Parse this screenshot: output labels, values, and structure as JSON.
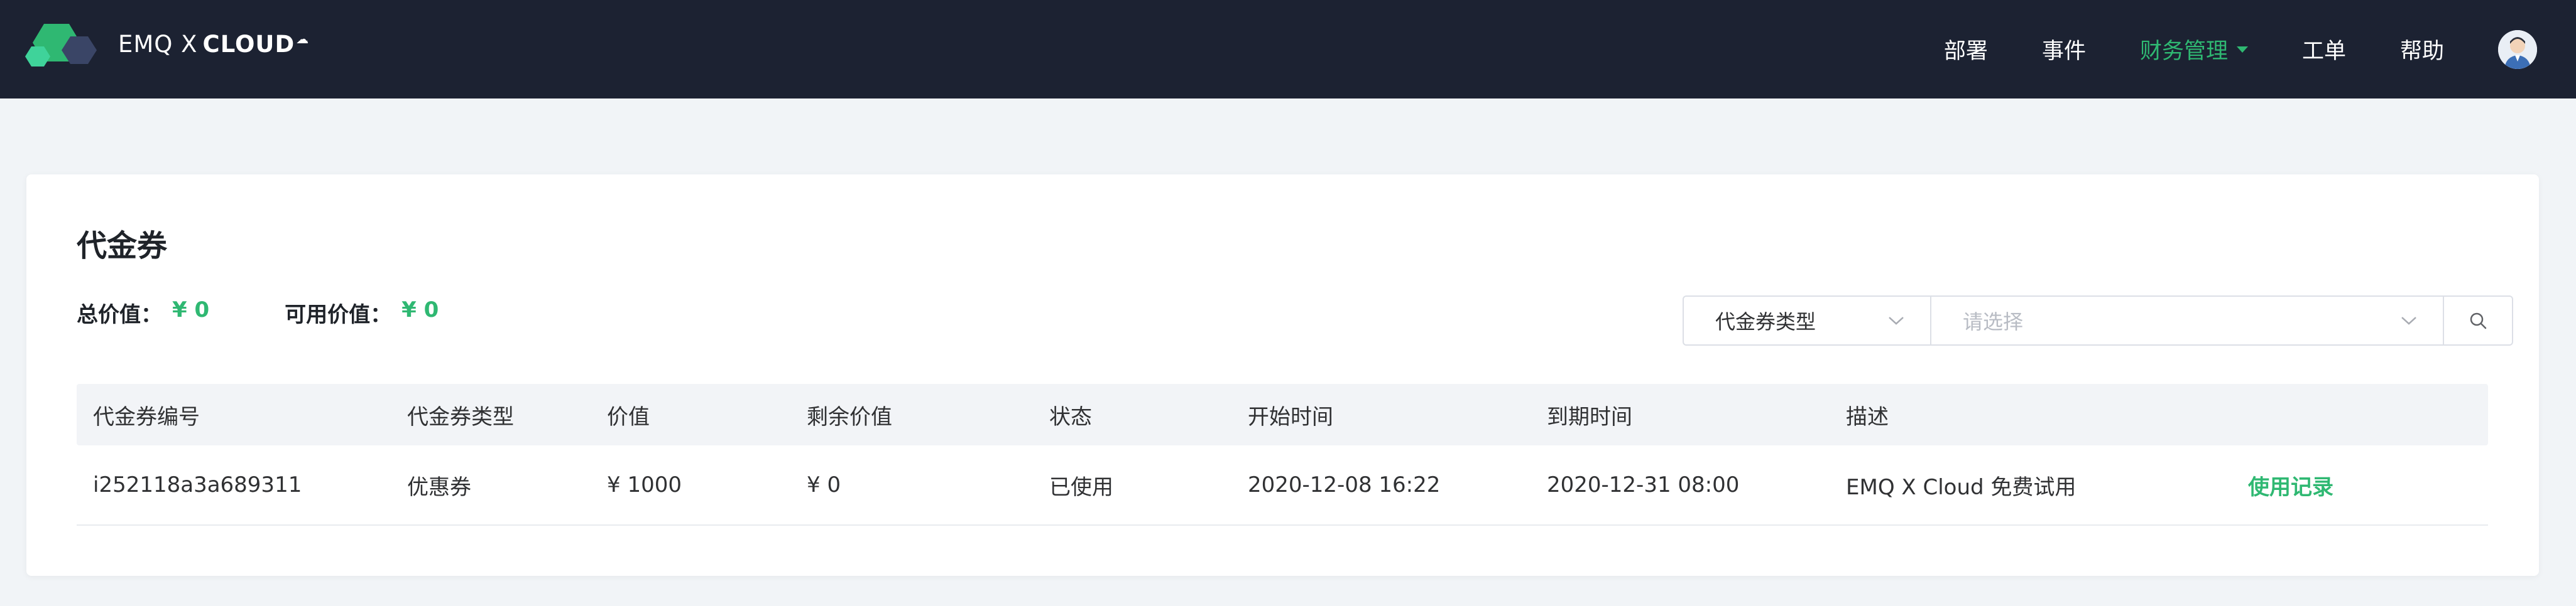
{
  "header": {
    "brand_left": "EMQ X",
    "brand_right": "CLOUD",
    "nav": [
      {
        "label": "部署"
      },
      {
        "label": "事件"
      },
      {
        "label": "财务管理",
        "active": true
      },
      {
        "label": "工单"
      },
      {
        "label": "帮助"
      }
    ],
    "colors": {
      "bar": "#1c2232",
      "accent": "#2fb872"
    }
  },
  "page": {
    "title": "代金券",
    "summary": {
      "total_label": "总价值：",
      "total_value": "¥ 0",
      "available_label": "可用价值：",
      "available_value": "¥ 0"
    },
    "filter": {
      "type_label": "代金券类型",
      "select_placeholder": "请选择",
      "search_icon": "search-icon"
    },
    "table": {
      "headers": [
        "代金券编号",
        "代金券类型",
        "价值",
        "剩余价值",
        "状态",
        "开始时间",
        "到期时间",
        "描述",
        ""
      ],
      "rows": [
        {
          "id": "i252118a3a689311",
          "type": "优惠券",
          "value": "¥ 1000",
          "remaining": "¥ 0",
          "status": "已使用",
          "start": "2020-12-08 16:22",
          "end": "2020-12-31 08:00",
          "desc": "EMQ X Cloud 免费试用",
          "action": "使用记录"
        }
      ]
    }
  }
}
